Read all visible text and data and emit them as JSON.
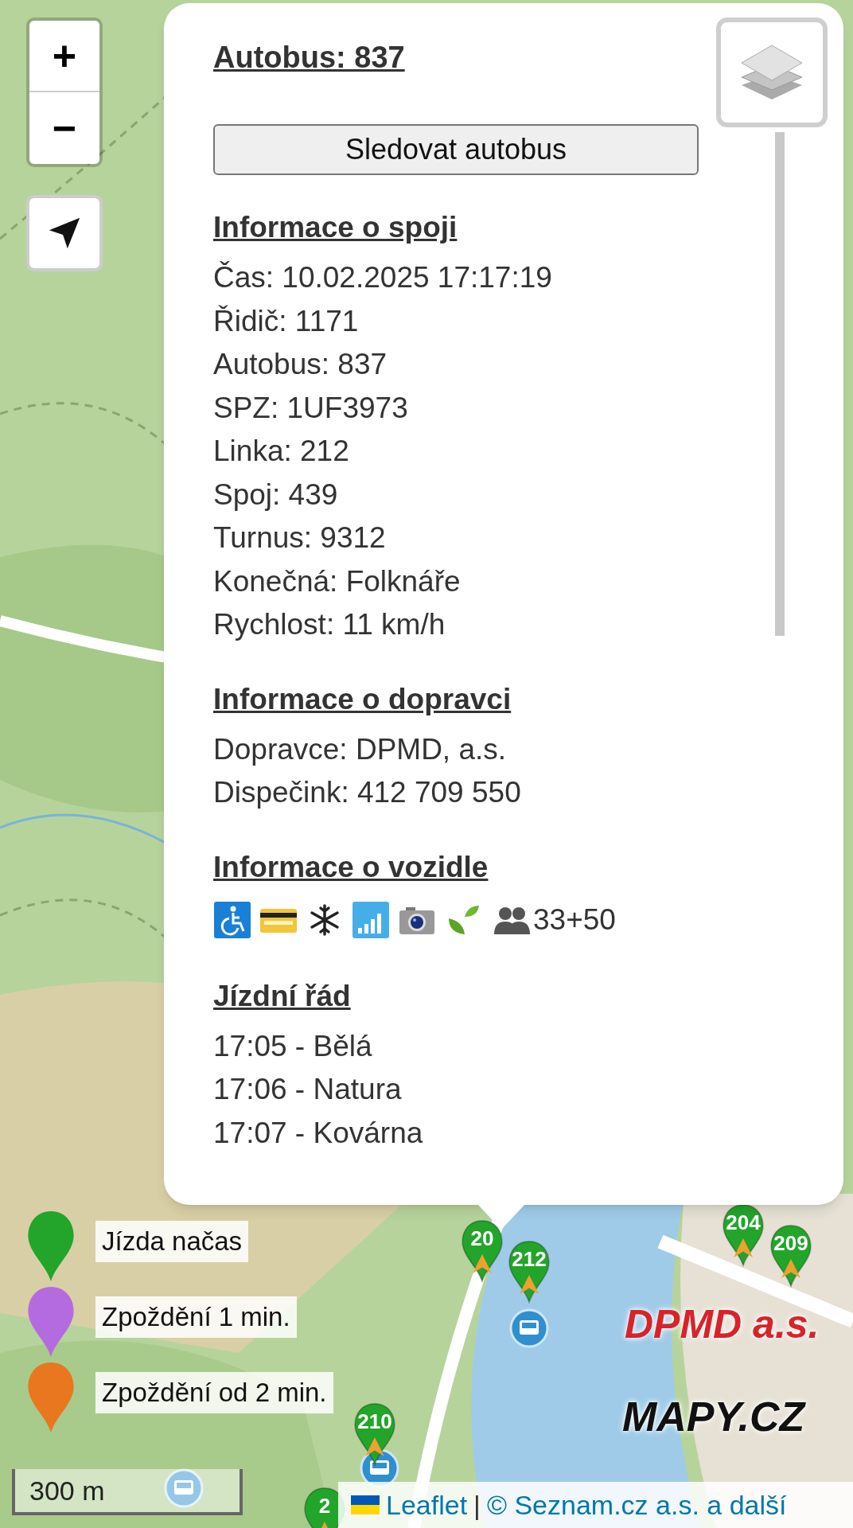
{
  "zoom_control": {
    "zoom_in": "+",
    "zoom_out": "−"
  },
  "popup": {
    "title": "Autobus: 837",
    "follow_button": "Sledovat autobus",
    "sections": [
      {
        "kind": "lines",
        "heading": "Informace o spoji",
        "lines": [
          "Čas: 10.02.2025 17:17:19",
          "Řidič: 1171",
          "Autobus: 837",
          "SPZ: 1UF3973",
          "Linka: 212",
          "Spoj: 439",
          "Turnus: 9312",
          "Konečná: Folknáře",
          "Rychlost: 11 km/h"
        ]
      },
      {
        "kind": "lines",
        "heading": "Informace o dopravci",
        "lines": [
          "Dopravce: DPMD, a.s.",
          "Dispečink: 412 709 550"
        ]
      },
      {
        "kind": "features",
        "heading": "Informace o vozidle",
        "features": [
          {
            "kind": "wheelchair"
          },
          {
            "kind": "card"
          },
          {
            "kind": "ac"
          },
          {
            "kind": "wifi"
          },
          {
            "kind": "camera"
          },
          {
            "kind": "eco"
          }
        ],
        "capacity": "33+50"
      },
      {
        "kind": "lines",
        "heading": "Jízdní řád",
        "lines": [
          "17:05 - Bělá",
          "17:06 - Natura",
          "17:07 - Kovárna"
        ]
      }
    ]
  },
  "legend": [
    {
      "label": "Jízda načas",
      "color": "#22a52a"
    },
    {
      "label": "Zpoždění 1 min.",
      "color": "#b56be0"
    },
    {
      "label": "Zpoždění od 2 min.",
      "color": "#e8771f"
    }
  ],
  "markers": [
    {
      "label": "20",
      "color": "#22a52a"
    },
    {
      "label": "212",
      "color": "#22a52a"
    },
    {
      "label": "204",
      "color": "#22a52a"
    },
    {
      "label": "209",
      "color": "#22a52a"
    },
    {
      "label": "210",
      "color": "#22a52a"
    },
    {
      "label": "2",
      "color": "#22a52a"
    }
  ],
  "logos": {
    "operator": "DPMD a.s.",
    "maps": "MAPY.CZ"
  },
  "scale": "300 m",
  "attribution": {
    "leaflet": "Leaflet",
    "separator": "|",
    "credit": "© Seznam.cz a.s. a další"
  }
}
